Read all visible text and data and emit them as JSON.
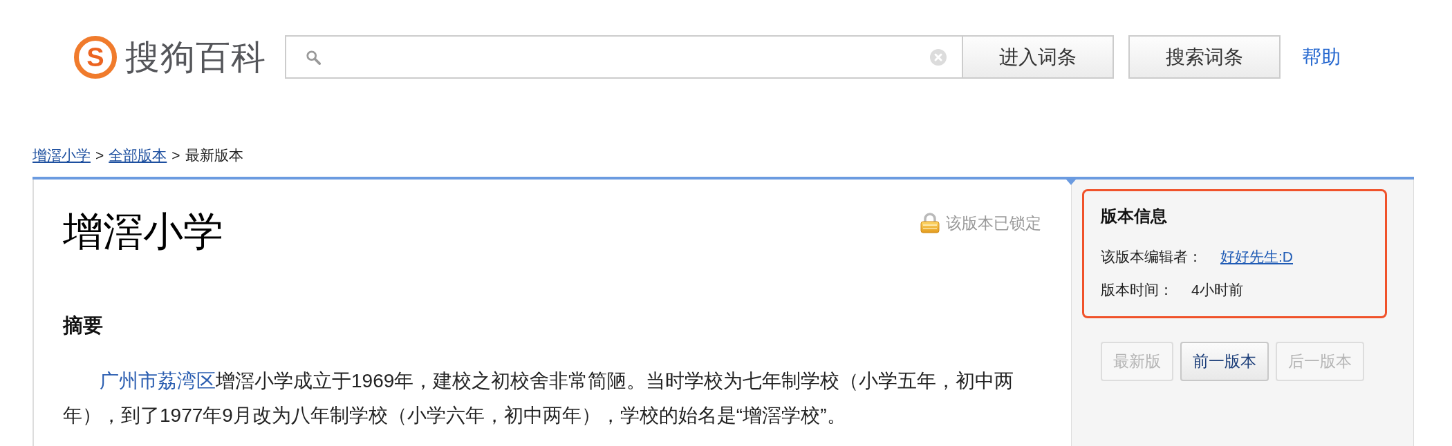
{
  "header": {
    "logo": {
      "mark": "S",
      "name": "搜狗百科"
    },
    "buttons": [
      {
        "label": "进入词条"
      },
      {
        "label": "搜索词条"
      }
    ],
    "help_link": "帮助"
  },
  "breadcrumb": [
    {
      "label": "增滘小学",
      "kind": "link",
      "separator": ">"
    },
    {
      "label": "全部版本",
      "kind": "link",
      "separator": ">"
    },
    {
      "label": "最新版本",
      "kind": "current"
    }
  ],
  "article": {
    "title": "增滘小学",
    "lock_notice": "该版本已锁定",
    "sections": [
      {
        "heading": "摘要",
        "paragraphs": [
          {
            "segments": [
              {
                "text": "广州市荔湾区",
                "kind": "link"
              },
              {
                "text": "增滘小学成立于1969年，建校之初校舍非常简陋。当时学校为七年制学校（小学五年，初中两年），到了1977年9月改为八年制学校（小学六年，初中两年），学校的始名是“增滘学校”。",
                "kind": "text"
              }
            ]
          }
        ]
      }
    ]
  },
  "version_info": {
    "title": "版本信息",
    "highlighted": true,
    "rows": [
      {
        "label": "该版本编辑者：",
        "value": "好好先生:D",
        "kind": "link"
      },
      {
        "label": "版本时间：",
        "value": "4小时前",
        "kind": "text"
      }
    ]
  },
  "version_nav": [
    {
      "label": "最新版",
      "disabled": true
    },
    {
      "label": "前一版本",
      "disabled": false
    },
    {
      "label": "后一版本",
      "disabled": true
    }
  ]
}
